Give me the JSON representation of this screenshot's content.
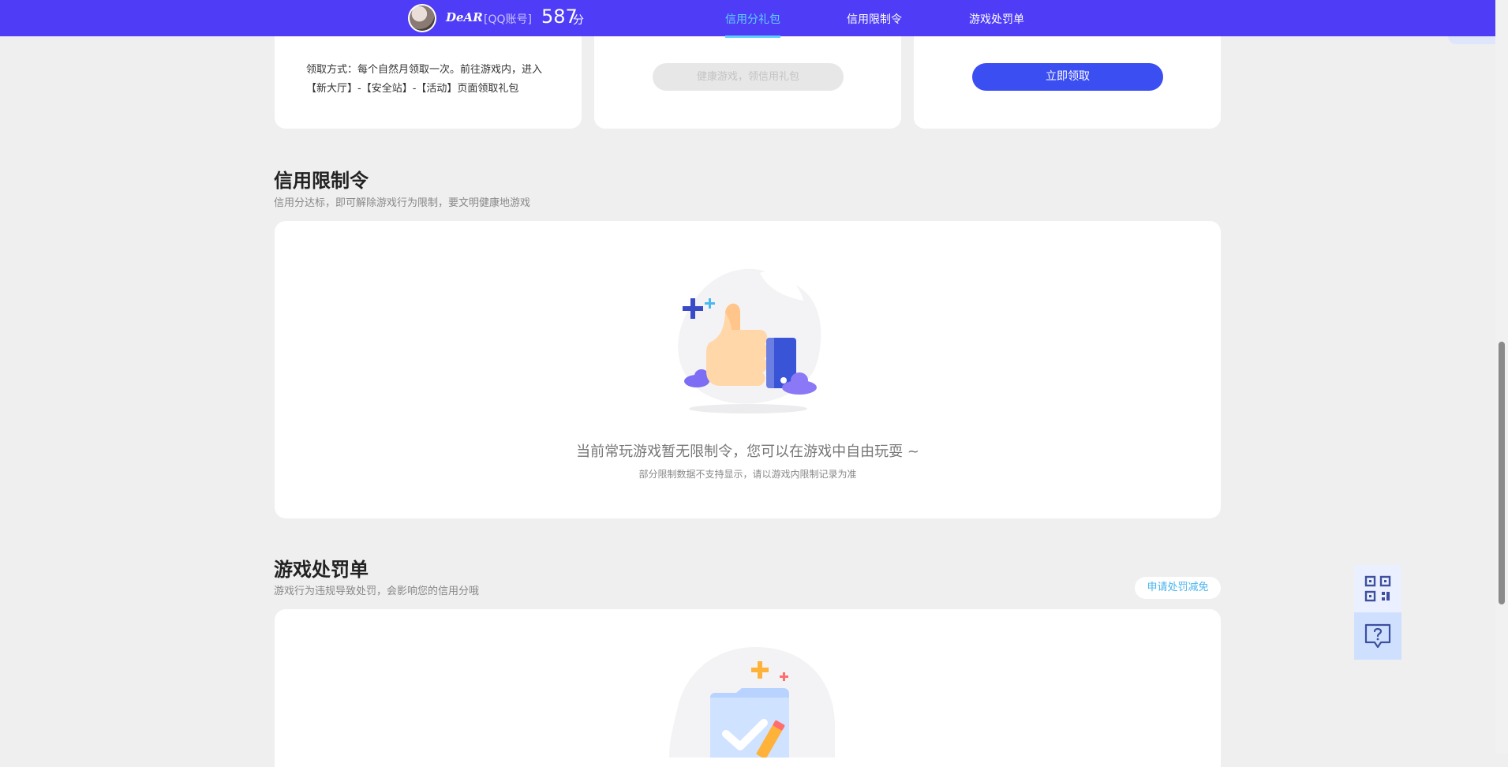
{
  "header": {
    "username": "DeAR",
    "account_type": "[QQ账号]",
    "score": "587",
    "score_unit": "分",
    "tabs": [
      {
        "label": "信用分礼包",
        "active": true
      },
      {
        "label": "信用限制令",
        "active": false
      },
      {
        "label": "游戏处罚单",
        "active": false
      }
    ]
  },
  "gift_cards": {
    "card1_text": "领取方式：每个自然月领取一次。前往游戏内，进入【新大厅】-【安全站】-【活动】页面领取礼包",
    "card2_button": "健康游戏，领信用礼包",
    "card3_button": "立即领取"
  },
  "restriction": {
    "title": "信用限制令",
    "subtitle": "信用分达标，即可解除游戏行为限制，要文明健康地游戏",
    "empty_main": "当前常玩游戏暂无限制令，您可以在游戏中自由玩耍 ~",
    "empty_sub": "部分限制数据不支持显示，请以游戏内限制记录为准"
  },
  "penalty": {
    "title": "游戏处罚单",
    "subtitle": "游戏行为违规导致处罚，会影响您的信用分哦",
    "appeal_button": "申请处罚减免"
  },
  "colors": {
    "topbar": "#4f3cf6",
    "active_tab": "#5fd0ff",
    "primary_button": "#3b4ef2"
  }
}
